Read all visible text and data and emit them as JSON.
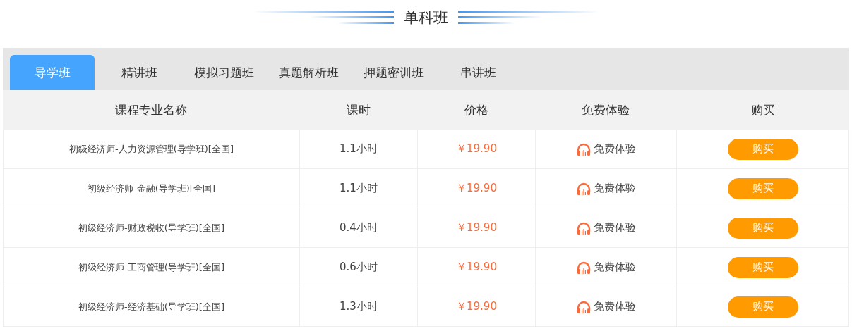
{
  "section_title": "单科班",
  "tabs": [
    {
      "label": "导学班",
      "selected": true
    },
    {
      "label": "精讲班",
      "selected": false
    },
    {
      "label": "模拟习题班",
      "selected": false
    },
    {
      "label": "真题解析班",
      "selected": false
    },
    {
      "label": "押题密训班",
      "selected": false
    },
    {
      "label": "串讲班",
      "selected": false
    }
  ],
  "table": {
    "columns": [
      "课程专业名称",
      "课时",
      "价格",
      "免费体验",
      "购买"
    ],
    "rows": [
      {
        "name": "初级经济师-人力资源管理(导学班)[全国]",
        "hours": "1.1小时",
        "price": "￥19.90",
        "trial": "免费体验",
        "buy": "购买"
      },
      {
        "name": "初级经济师-金融(导学班)[全国]",
        "hours": "1.1小时",
        "price": "￥19.90",
        "trial": "免费体验",
        "buy": "购买"
      },
      {
        "name": "初级经济师-财政税收(导学班)[全国]",
        "hours": "0.4小时",
        "price": "￥19.90",
        "trial": "免费体验",
        "buy": "购买"
      },
      {
        "name": "初级经济师-工商管理(导学班)[全国]",
        "hours": "0.6小时",
        "price": "￥19.90",
        "trial": "免费体验",
        "buy": "购买"
      },
      {
        "name": "初级经济师-经济基础(导学班)[全国]",
        "hours": "1.3小时",
        "price": "￥19.90",
        "trial": "免费体验",
        "buy": "购买"
      }
    ]
  }
}
